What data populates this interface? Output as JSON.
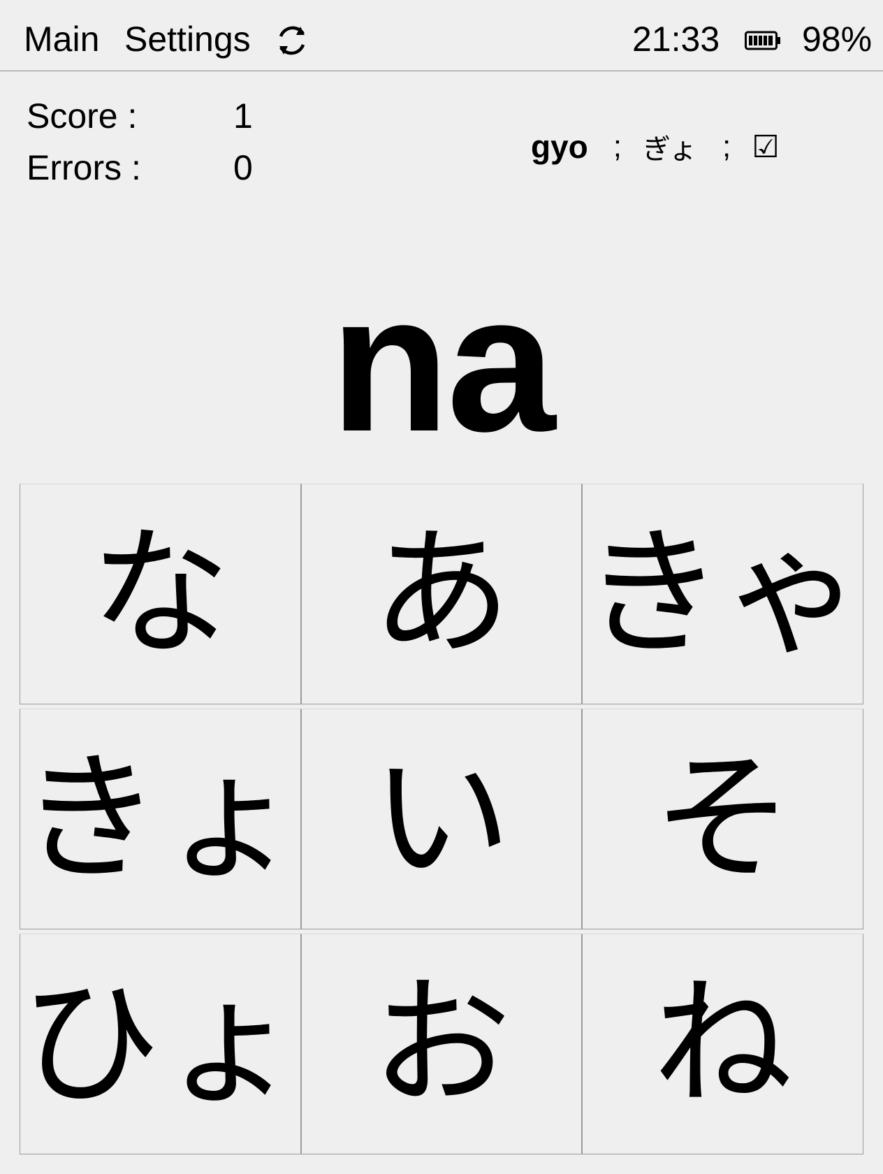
{
  "topbar": {
    "menu": [
      "Main",
      "Settings"
    ],
    "sync_icon": "sync-icon",
    "time": "21:33",
    "battery_icon": "battery-icon",
    "battery": "98%"
  },
  "stats": {
    "score_label": "Score :",
    "score": "1",
    "errors_label": "Errors :",
    "errors": "0"
  },
  "hint": {
    "romaji": "gyo",
    "separator": ";",
    "kana": "ぎょ",
    "check": "☑"
  },
  "prompt": "na",
  "answers": [
    "な",
    "あ",
    "きゃ",
    "きょ",
    "い",
    "そ",
    "ひょ",
    "お",
    "ね"
  ]
}
